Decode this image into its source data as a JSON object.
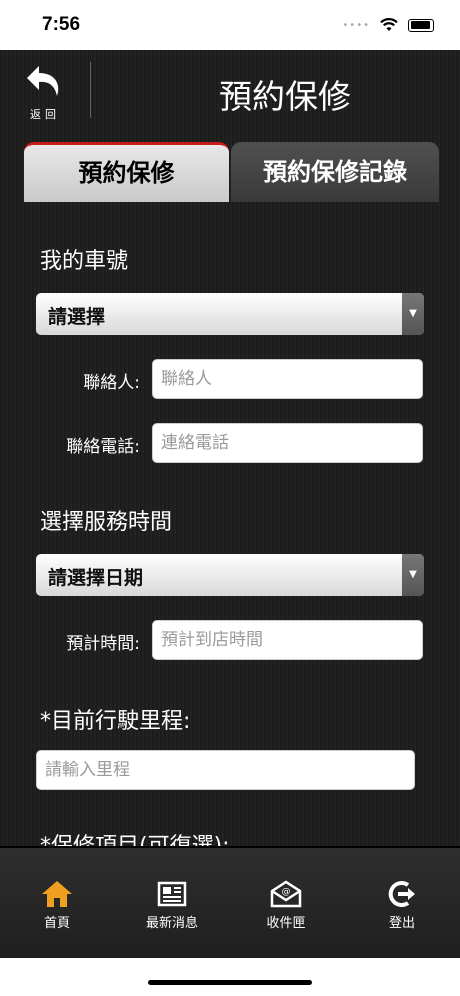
{
  "status_bar": {
    "time": "7:56"
  },
  "header": {
    "back_label": "返回",
    "title": "預約保修"
  },
  "tabs": [
    {
      "label": "預約保修"
    },
    {
      "label": "預約保修記錄"
    }
  ],
  "form": {
    "car_section_label": "我的車號",
    "car_select_value": "請選擇",
    "contact_label": "聯絡人:",
    "contact_placeholder": "聯絡人",
    "phone_label": "聯絡電話:",
    "phone_placeholder": "連絡電話",
    "time_section_label": "選擇服務時間",
    "date_select_value": "請選擇日期",
    "eta_label": "預計時間:",
    "eta_placeholder": "預計到店時間",
    "mileage_label": "*目前行駛里程:",
    "mileage_placeholder": "請輸入里程",
    "items_label": "*保修項目(可復選):"
  },
  "tabbar": [
    {
      "label": "首頁",
      "icon": "home-icon"
    },
    {
      "label": "最新消息",
      "icon": "news-icon"
    },
    {
      "label": "收件匣",
      "icon": "inbox-icon"
    },
    {
      "label": "登出",
      "icon": "logout-icon"
    }
  ],
  "colors": {
    "accent_red": "#c81d1d",
    "home_orange": "#f0a020"
  }
}
